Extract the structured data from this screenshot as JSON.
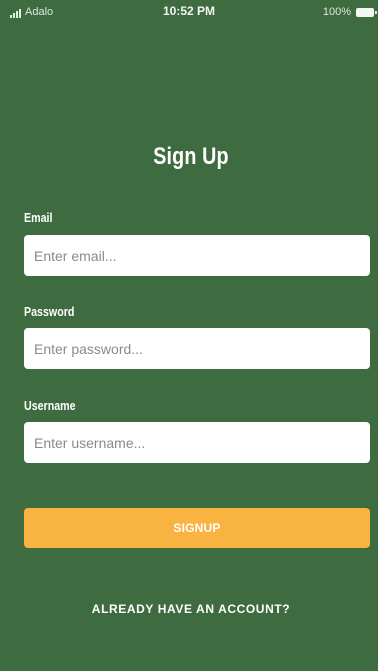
{
  "status_bar": {
    "carrier": "Adalo",
    "time": "10:52 PM",
    "battery": "100%"
  },
  "page": {
    "title": "Sign Up"
  },
  "form": {
    "email": {
      "label": "Email",
      "placeholder": "Enter email..."
    },
    "password": {
      "label": "Password",
      "placeholder": "Enter password..."
    },
    "username": {
      "label": "Username",
      "placeholder": "Enter username..."
    },
    "submit_label": "SIGNUP"
  },
  "footer": {
    "login_link": "ALREADY HAVE AN ACCOUNT?"
  },
  "colors": {
    "background": "#3f6b40",
    "button": "#f9b340",
    "text": "#ffffff"
  },
  "icons": [
    "signal-icon",
    "battery-icon"
  ]
}
